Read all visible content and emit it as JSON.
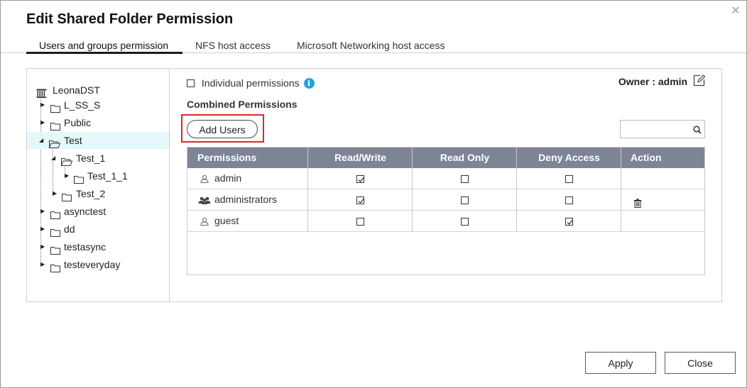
{
  "dialog": {
    "title": "Edit Shared Folder Permission",
    "close_icon": "close-icon"
  },
  "tabs": [
    {
      "label": "Users and groups permission",
      "active": true
    },
    {
      "label": "NFS host access",
      "active": false
    },
    {
      "label": "Microsoft Networking host access",
      "active": false
    }
  ],
  "tree": {
    "root": "LeonaDST",
    "items": [
      {
        "label": "L_SS_S",
        "expanded": false
      },
      {
        "label": "Public",
        "expanded": false
      },
      {
        "label": "Test",
        "expanded": true,
        "selected": true
      },
      {
        "label": "Test_1",
        "expanded": true
      },
      {
        "label": "Test_1_1",
        "expanded": false
      },
      {
        "label": "Test_2",
        "expanded": false
      },
      {
        "label": "asynctest",
        "expanded": false
      },
      {
        "label": "dd",
        "expanded": false
      },
      {
        "label": "testasync",
        "expanded": false
      },
      {
        "label": "testeveryday",
        "expanded": false
      }
    ]
  },
  "permissions": {
    "individual_label": "Individual permissions",
    "individual_checked": false,
    "owner_label": "Owner :",
    "owner_value": "admin",
    "combined_title": "Combined Permissions",
    "add_users_label": "Add Users",
    "search_placeholder": "",
    "columns": [
      "Permissions",
      "Read/Write",
      "Read Only",
      "Deny Access",
      "Action"
    ],
    "rows": [
      {
        "name": "admin",
        "type": "user",
        "rw": true,
        "ro": false,
        "deny": false,
        "deletable": false
      },
      {
        "name": "administrators",
        "type": "group",
        "rw": true,
        "ro": false,
        "deny": false,
        "deletable": true
      },
      {
        "name": "guest",
        "type": "user",
        "rw": false,
        "ro": false,
        "deny": true,
        "deletable": false
      }
    ]
  },
  "footer": {
    "apply_label": "Apply",
    "close_label": "Close"
  },
  "colors": {
    "header_bg": "#7d8595",
    "selected_row_bg": "#e4f7fb",
    "highlight_border": "#e0272e",
    "info_icon": "#1ea2e6"
  }
}
